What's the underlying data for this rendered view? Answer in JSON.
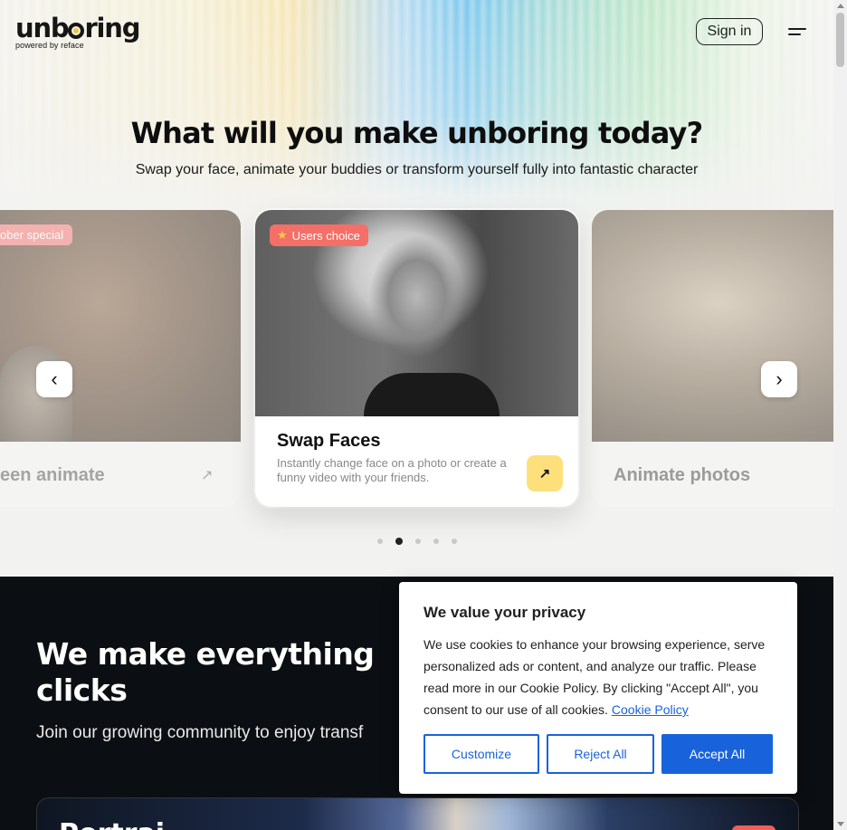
{
  "header": {
    "logo_text": "unboring",
    "logo_sub": "powered by reface",
    "signin_label": "Sign in",
    "menu_icon": "hamburger-menu-icon"
  },
  "hero": {
    "title": "What will you make unboring today?",
    "subtitle": "Swap your face, animate your buddies or transform yourself fully into fantastic character"
  },
  "carousel": {
    "prev_label": "‹",
    "next_label": "›",
    "cards": [
      {
        "badge": "ober special",
        "title": "een animate",
        "arrow": "↗"
      },
      {
        "badge": "Users choice",
        "badge_icon": "star-icon",
        "title": "Swap Faces",
        "desc": "Instantly change face on a photo or create a funny video with your friends.",
        "arrow": "↗"
      },
      {
        "title": "Animate photos"
      }
    ],
    "dots_count": 5,
    "active_dot": 2
  },
  "dark_section": {
    "headline_line1": "We make everything",
    "headline_line2": "clicks",
    "join_text": "Join our growing community to enjoy transf",
    "promo_title": "Portrai"
  },
  "cookie": {
    "title": "We value your privacy",
    "text": "We use cookies to enhance your browsing experience, serve personalized ads or content, and analyze our traffic. Please read more in our Cookie Policy. By clicking \"Accept All\", you consent to our use of all cookies.",
    "link_label": "Cookie Policy",
    "customize_label": "Customize",
    "reject_label": "Reject All",
    "accept_label": "Accept All"
  },
  "colors": {
    "accent_blue": "#1863dc",
    "badge_red": "#f46f68",
    "go_yellow": "#fde07c",
    "dark_bg": "#0b0e12"
  }
}
